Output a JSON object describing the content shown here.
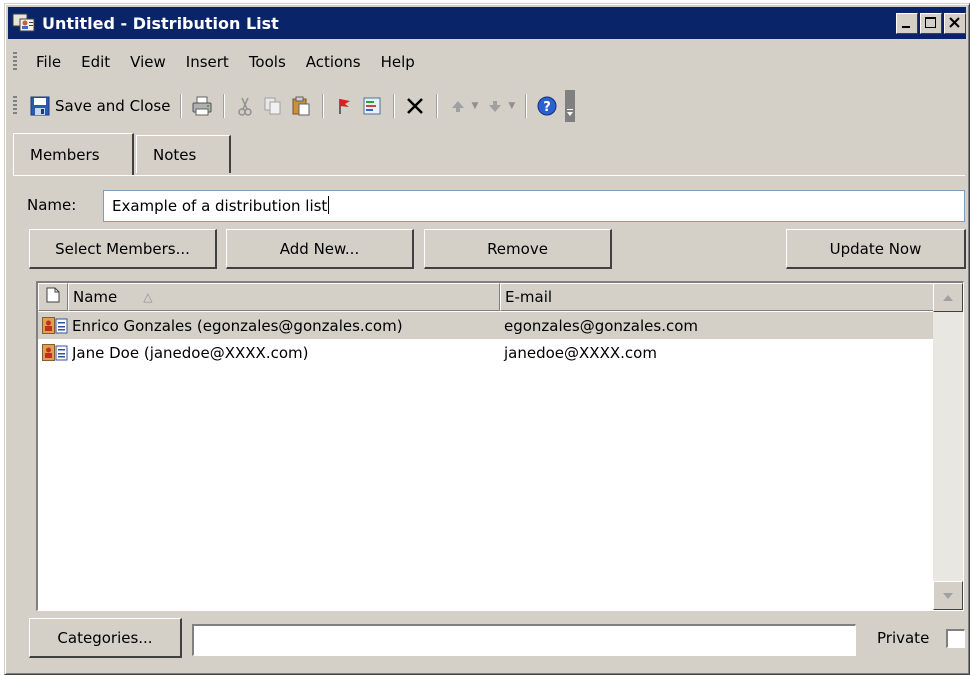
{
  "window": {
    "title": "Untitled - Distribution List"
  },
  "menubar": {
    "items": [
      {
        "label": "File"
      },
      {
        "label": "Edit"
      },
      {
        "label": "View"
      },
      {
        "label": "Insert"
      },
      {
        "label": "Tools"
      },
      {
        "label": "Actions"
      },
      {
        "label": "Help"
      }
    ]
  },
  "toolbar": {
    "save_close_label": "Save and Close",
    "icons": [
      "save-icon",
      "print-icon",
      "cut-icon",
      "copy-icon",
      "paste-icon",
      "flag-icon",
      "categories-icon",
      "delete-icon",
      "previous-item-icon",
      "next-item-icon",
      "help-icon"
    ]
  },
  "tabs": [
    {
      "label": "Members",
      "active": true
    },
    {
      "label": "Notes",
      "active": false
    }
  ],
  "name_field": {
    "label": "Name:",
    "value": "Example of a distribution list"
  },
  "buttons": {
    "select_members": "Select Members...",
    "add_new": "Add New...",
    "remove": "Remove",
    "update_now": "Update Now"
  },
  "members_list": {
    "columns": [
      "Name",
      "E-mail"
    ],
    "sort_indicator": "△",
    "rows": [
      {
        "name": "Enrico Gonzales (egonzales@gonzales.com)",
        "email": "egonzales@gonzales.com",
        "selected": true
      },
      {
        "name": "Jane Doe (janedoe@XXXX.com)",
        "email": "janedoe@XXXX.com",
        "selected": false
      }
    ]
  },
  "bottom": {
    "categories_button": "Categories...",
    "categories_value": "",
    "private_label": "Private",
    "private_checked": false
  },
  "colors": {
    "titlebar": "#0a246a",
    "face": "#d4d0c8",
    "selected_row": "#d4d0c8"
  }
}
